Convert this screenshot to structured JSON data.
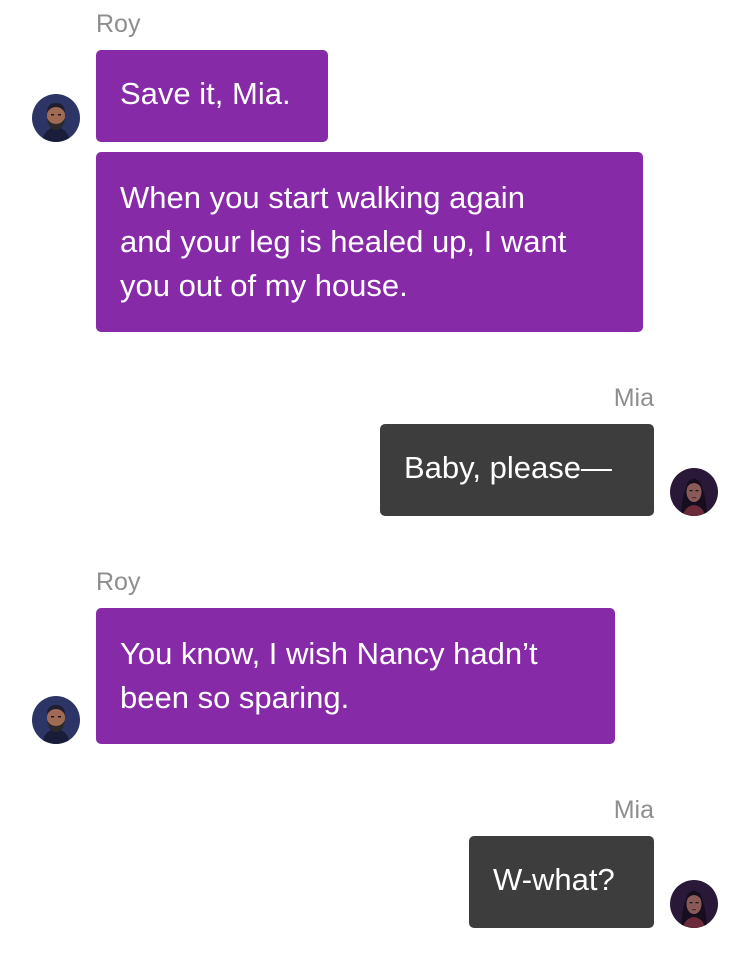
{
  "conversation": {
    "messages": [
      {
        "sender": "Roy",
        "text": "Save it, Mia."
      },
      {
        "sender": "Roy",
        "lines": [
          "When you start walking again",
          "and your leg is healed up, I want",
          "you out of my house."
        ]
      },
      {
        "sender": "Mia",
        "text": "Baby, please—"
      },
      {
        "sender": "Roy",
        "lines": [
          "You know, I wish Nancy hadn’t",
          "been so sparing."
        ]
      },
      {
        "sender": "Mia",
        "text": "W-what?"
      }
    ],
    "labels": {
      "roy_1": "Roy",
      "mia_1": "Mia",
      "roy_2": "Roy",
      "mia_2": "Mia"
    },
    "avatars": {
      "roy": "roy-avatar-icon",
      "mia": "mia-avatar-icon"
    }
  },
  "colors": {
    "roy_bubble": "#872aa8",
    "mia_bubble": "#3d3d3d",
    "sender_label": "#8e8e8e",
    "background": "#ffffff"
  }
}
